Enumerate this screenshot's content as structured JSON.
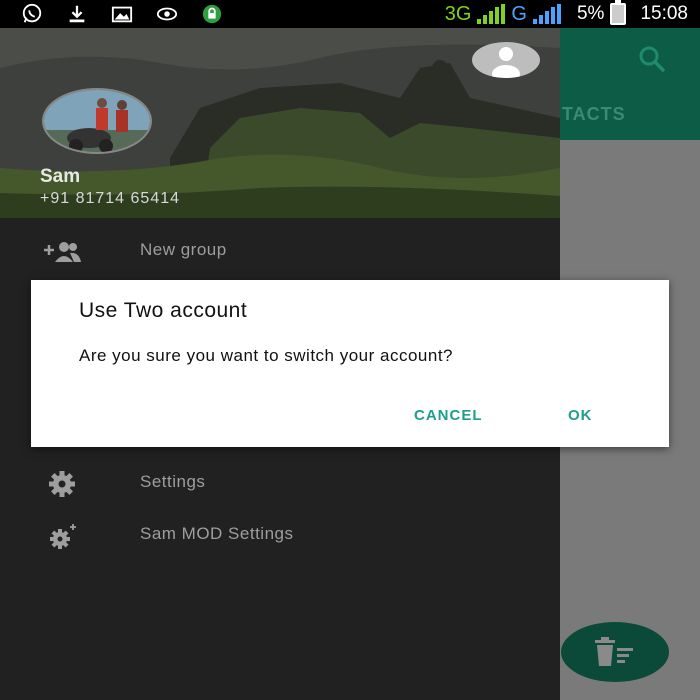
{
  "status_bar": {
    "network_1": "3G",
    "network_2": "G",
    "battery": "5%",
    "time": "15:08",
    "icons": [
      "whatsapp-icon",
      "download-icon",
      "image-icon",
      "eye-icon",
      "lock-icon"
    ]
  },
  "app": {
    "tab_partial_label": "NTACTS",
    "toolbar_color": "#0d5c45"
  },
  "drawer": {
    "profile": {
      "name": "Sam",
      "phone": "+91 81714 65414"
    },
    "items": [
      {
        "label": "New group",
        "icon": "add-group-icon"
      },
      {
        "label": "Settings",
        "icon": "gear-icon"
      },
      {
        "label": "Sam MOD Settings",
        "icon": "gear-plus-icon"
      }
    ]
  },
  "dialog": {
    "title": "Use Two account",
    "message": "Are you sure you want to switch your account?",
    "cancel_label": "CANCEL",
    "ok_label": "OK",
    "accent": "#1f9e89"
  }
}
